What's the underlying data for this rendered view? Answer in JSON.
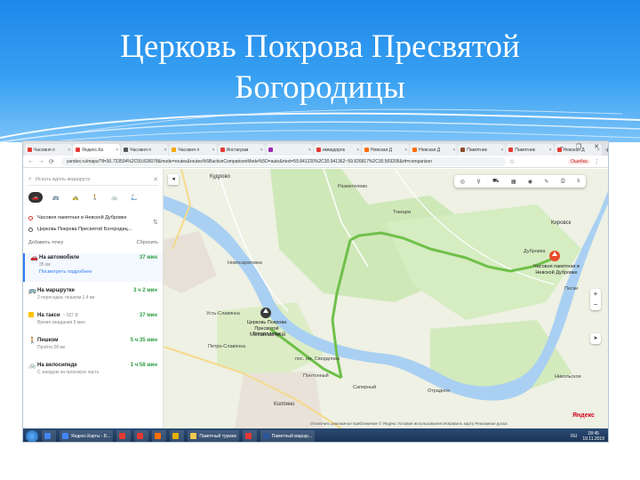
{
  "slide": {
    "title": "Церковь Покрова Пресвятой Богородицы"
  },
  "browser": {
    "tabs": [
      {
        "label": "Часовня п",
        "color": "#e53935"
      },
      {
        "label": "Яндекс.Ка",
        "color": "#e53935"
      },
      {
        "label": "Часовня п",
        "color": "#555555"
      },
      {
        "label": "Часовня п",
        "color": "#f2a900"
      },
      {
        "label": "Инстаграм",
        "color": "#e53935"
      },
      {
        "label": "",
        "color": "#9c27b0"
      },
      {
        "label": "имвадорок",
        "color": "#e53935"
      },
      {
        "label": "Невская Д",
        "color": "#ff6d00"
      },
      {
        "label": "Невская Д",
        "color": "#ff6d00"
      },
      {
        "label": "Памятник",
        "color": "#8d4a2a"
      },
      {
        "label": "Памятник",
        "color": "#e53935"
      },
      {
        "label": "Невская Д",
        "color": "#e53935"
      }
    ],
    "url": "yandex.ru/maps/?ll=30.723594%2C59.826078&mode=routes&routes%5BactiveComparisonMode%5D=auto&rtext=59.841220%2C30.941362~59.826817%2C30.569205&rtt=comparison",
    "error_badge": "Ошибка"
  },
  "sidebar": {
    "search_placeholder": "Искать вдоль маршрута",
    "from": "Часовня памятная в Невской Дубровке",
    "to": "Церковь Покрова Пресвятой Богородиц...",
    "add_point": "Добавить точку",
    "reset": "Сбросить",
    "options": [
      {
        "name": "На автомобиле",
        "price": "",
        "time": "37 мин",
        "sub": "35 км",
        "link": "Посмотреть подробнее"
      },
      {
        "name": "На маршрутке",
        "price": "",
        "time": "3 ч 2 мин",
        "sub": "2 пересадки, пешком 1,4 км",
        "link": ""
      },
      {
        "name": "На такси",
        "price": "~ 927 ₽",
        "time": "37 мин",
        "sub": "Время ожидания 5 мин",
        "link": ""
      },
      {
        "name": "Пешком",
        "price": "",
        "time": "5 ч 35 мин",
        "sub": "Пройти 28 км",
        "link": ""
      },
      {
        "name": "На велосипеде",
        "price": "",
        "time": "1 ч 58 мин",
        "sub": "С заездом на проезжую часть",
        "link": ""
      }
    ]
  },
  "map": {
    "places": {
      "kudrovo": "Кудрово",
      "razmetelevo": "Разметелево",
      "tokkari": "Токкари",
      "kirovsk": "Кировск",
      "dubrovka": "Дубровка",
      "pesky": "Пески",
      "novosaratovka": "Новосаратовка",
      "metallostroy": "Металлострой",
      "ust_slavyanka": "Усть-Славянка",
      "petro_slavyanka": "Петро-Славянка",
      "pos_imeni": "пос. им. Свердлова",
      "pontonny": "Понтонный",
      "sapyorny": "Саперный",
      "otradnoe": "Отрадное",
      "kolpino": "Колпино",
      "nikolskoe": "Никольское"
    },
    "pin_church": "Церковь Покрова Пресвятой Богородицы",
    "pin_chapel": "Часовня памятная в Невской Дубровке",
    "logo": "Яндекс",
    "attribution": "Отключить рекламное приближение   © Яндекс  Условия использования   Исправить карту   Рекламная доска"
  },
  "taskbar": {
    "items": [
      {
        "label": "",
        "color": "#4285f4"
      },
      {
        "label": "Яндекс.Карты - Б...",
        "color": "#4285f4"
      },
      {
        "label": "",
        "color": "#e53935"
      },
      {
        "label": "",
        "color": "#e53935"
      },
      {
        "label": "",
        "color": "#ff6d00"
      },
      {
        "label": "",
        "color": "#e5b100"
      },
      {
        "label": "Памятный туризм",
        "color": "#f2c94c"
      },
      {
        "label": "",
        "color": "#e53935"
      },
      {
        "label": "Памятный маршр...",
        "color": "#2b579a"
      }
    ],
    "lang": "RU",
    "time": "18:45",
    "date": "19.11.2019"
  }
}
